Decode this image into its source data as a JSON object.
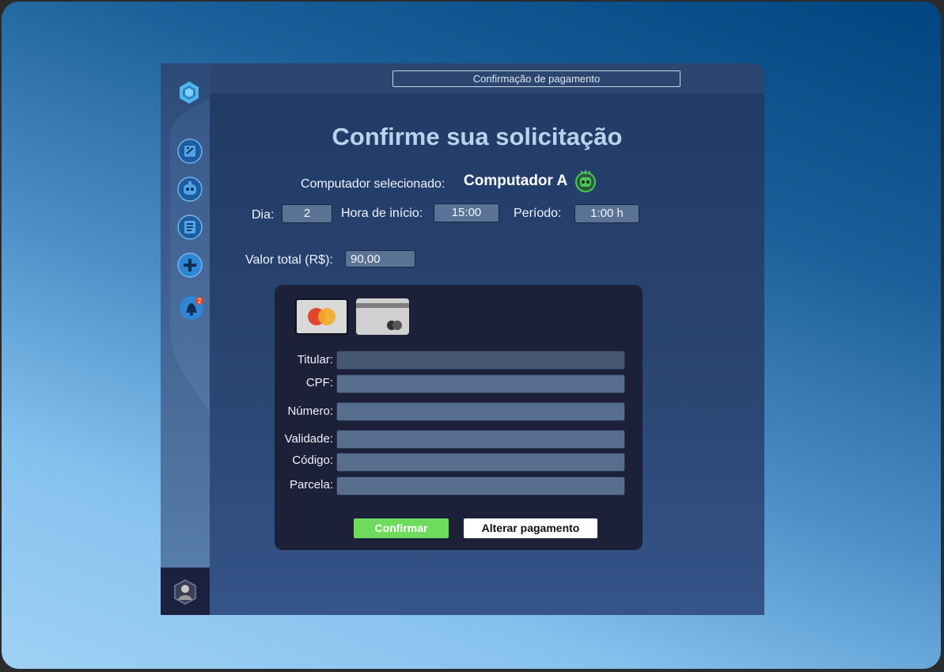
{
  "header": {
    "title": "Confirmação de pagamento"
  },
  "main": {
    "title": "Confirme sua solicitação",
    "computer_label": "Computador selecionado:",
    "computer_name": "Computador A",
    "day_label": "Dia:",
    "day_value": "2",
    "start_label": "Hora de início:",
    "start_value": "15:00",
    "period_label": "Período:",
    "period_value": "1:00 h",
    "total_label": "Valor total (R$):",
    "total_value": "90,00"
  },
  "payment": {
    "fields": [
      {
        "label": "Titular:"
      },
      {
        "label": "CPF:"
      },
      {
        "label": "Número:"
      },
      {
        "label": "Validade:"
      },
      {
        "label": "Código:"
      },
      {
        "label": "Parcela:"
      }
    ],
    "confirm_label": "Confirmar",
    "alter_label": "Alterar pagamento"
  },
  "sidebar": {
    "items": [
      {
        "icon": "hexagon-logo-icon"
      },
      {
        "icon": "chip-icon"
      },
      {
        "icon": "robot-icon"
      },
      {
        "icon": "list-icon"
      },
      {
        "icon": "plus-icon"
      },
      {
        "icon": "bell-icon",
        "badge": "2"
      }
    ],
    "profile_icon": "avatar"
  },
  "colors": {
    "confirm": "#6edb5c",
    "accent": "#4fa6e6",
    "robot": "#46c45a"
  }
}
